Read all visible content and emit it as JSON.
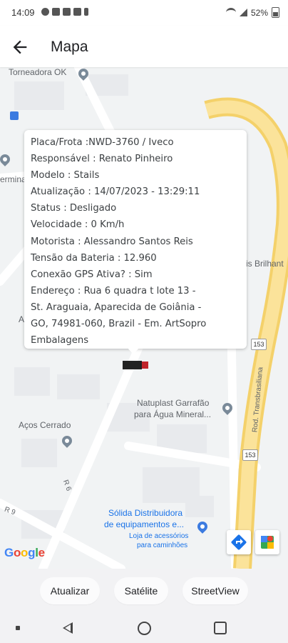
{
  "status_bar": {
    "time": "14:09",
    "battery": "52%"
  },
  "app_bar": {
    "title": "Mapa"
  },
  "map": {
    "labels": {
      "torneadora": "Torneadora OK",
      "termina": "ermina",
      "brilhant": "is Brilhant",
      "natuplast_1": "Natuplast Garrafão",
      "natuplast_2": "para Água Mineral...",
      "acos": "Aços Cerrado",
      "solida_1": "Sólida Distribuidora",
      "solida_2": "de equipamentos e...",
      "loja_1": "Loja de acessórios",
      "loja_2": "para caminhões",
      "r6": "R 6",
      "r9": "R 9",
      "rod": "Rod. Transbrasiliana",
      "shield_153a": "153",
      "shield_153b": "153",
      "a_letter": "A",
      "google": "Google"
    },
    "info_window": {
      "lines": [
        "Placa/Frota :NWD-3760 / Iveco",
        "Responsável : Renato Pinheiro",
        "Modelo : Stails",
        "Atualização : 14/07/2023 - 13:29:11",
        "Status : Desligado",
        "Velocidade : 0 Km/h",
        "Motorista : Alessandro Santos Reis",
        "Tensão da Bateria : 12.960",
        "Conexão GPS Ativa? : Sim",
        "Endereço : Rua 6 quadra t lote 13 -",
        "St. Araguaia, Aparecida de Goiânia -",
        "GO, 74981-060, Brazil - Em. ArtSopro",
        "Embalagens"
      ]
    }
  },
  "buttons": {
    "atualizar": "Atualizar",
    "satelite": "Satélite",
    "streetview": "StreetView"
  },
  "icons": {
    "back": "arrow-left-icon",
    "directions": "directions-icon",
    "maps": "google-maps-icon",
    "truck": "truck-marker-icon"
  },
  "colors": {
    "highway": "#f7d774",
    "map_bg": "#f1f3f4",
    "accent": "#1a73e8"
  }
}
